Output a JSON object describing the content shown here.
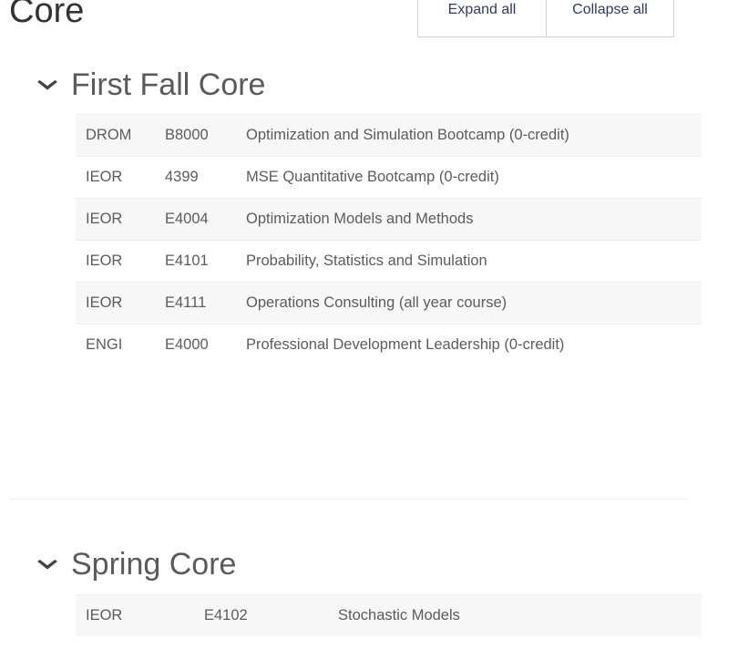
{
  "header": {
    "title": "Core",
    "expand_label": "Expand all",
    "collapse_label": "Collapse all"
  },
  "sections": [
    {
      "title": "First Fall Core",
      "chevron": "chevron-down-icon",
      "chevron_glyph": "⌄",
      "courses": [
        {
          "dept": "DROM",
          "code": "B8000",
          "title": "Optimization and Simulation Bootcamp (0-credit)"
        },
        {
          "dept": "IEOR",
          "code": "4399",
          "title": "MSE Quantitative Bootcamp (0-credit)"
        },
        {
          "dept": "IEOR",
          "code": "E4004",
          "title": "Optimization Models and Methods"
        },
        {
          "dept": "IEOR",
          "code": "E4101",
          "title": "Probability, Statistics and Simulation"
        },
        {
          "dept": "IEOR",
          "code": "E4111",
          "title": "Operations Consulting (all year course)"
        },
        {
          "dept": "ENGI",
          "code": "E4000",
          "title": "Professional Development Leadership (0-credit)"
        }
      ]
    },
    {
      "title": "Spring Core",
      "chevron": "chevron-down-icon",
      "chevron_glyph": "⌄",
      "courses": [
        {
          "dept": "IEOR",
          "code": "E4102",
          "title": "Stochastic Models"
        }
      ]
    }
  ],
  "colors": {
    "button_text": "#2f3b62",
    "button_border": "#d0d0d0",
    "title_text": "#333333",
    "section_title_text": "#5a5a5a",
    "table_text": "#5c5c5c",
    "row_stripe": "#f7f7f7",
    "row_border": "#ededed",
    "divider": "#ececec"
  }
}
